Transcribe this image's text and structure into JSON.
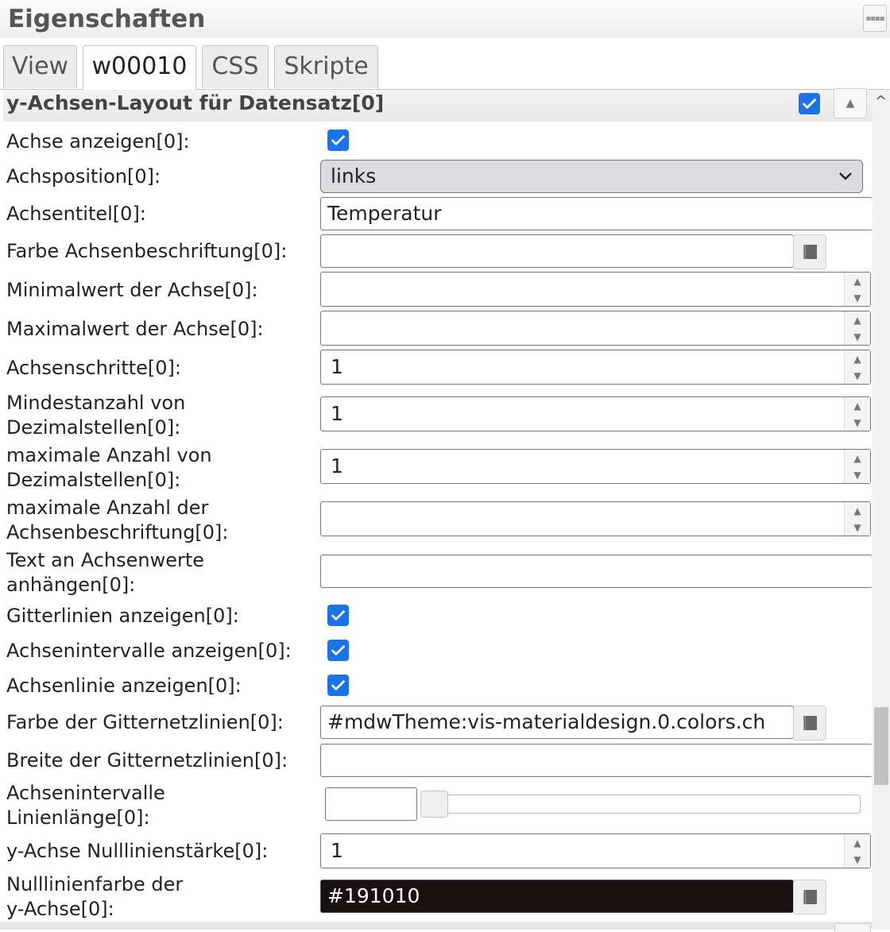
{
  "panel": {
    "title": "Eigenschaften"
  },
  "tabs": [
    "View",
    "w00010",
    "CSS",
    "Skripte"
  ],
  "active_tab": "w00010",
  "section": {
    "title": "y-Achsen-Layout für Datensatz[0]",
    "enabled": true
  },
  "fields": {
    "show_axis": {
      "label": "Achse anzeigen[0]:",
      "checked": true
    },
    "axis_position": {
      "label": "Achsposition[0]:",
      "value": "links"
    },
    "axis_title": {
      "label": "Achsentitel[0]:",
      "value": "Temperatur"
    },
    "axis_label_color": {
      "label": "Farbe Achsenbeschriftung[0]:",
      "value": ""
    },
    "axis_min": {
      "label": "Minimalwert der Achse[0]:",
      "value": ""
    },
    "axis_max": {
      "label": "Maximalwert der Achse[0]:",
      "value": ""
    },
    "axis_steps": {
      "label": "Achsenschritte[0]:",
      "value": "1"
    },
    "min_decimals": {
      "label1": "Mindestanzahl von",
      "label2": "Dezimalstellen[0]:",
      "value": "1"
    },
    "max_decimals": {
      "label1": "maximale Anzahl von",
      "label2": "Dezimalstellen[0]:",
      "value": "1"
    },
    "max_axis_labels": {
      "label1": "maximale Anzahl der",
      "label2": "Achsenbeschriftung[0]:",
      "value": ""
    },
    "append_text": {
      "label1": "Text an Achsenwerte",
      "label2": "anhängen[0]:",
      "value": ""
    },
    "show_gridlines": {
      "label": "Gitterlinien anzeigen[0]:",
      "checked": true
    },
    "show_intervals": {
      "label": "Achsenintervalle anzeigen[0]:",
      "checked": true
    },
    "show_axis_line": {
      "label": "Achsenlinie anzeigen[0]:",
      "checked": true
    },
    "grid_color": {
      "label": "Farbe der Gitternetzlinien[0]:",
      "value": "#mdwTheme:vis-materialdesign.0.colors.ch"
    },
    "grid_width": {
      "label": "Breite der Gitternetzlinien[0]:",
      "value": ""
    },
    "interval_length": {
      "label1": "Achsenintervalle",
      "label2": "Linienlänge[0]:",
      "value": "",
      "slider_fraction": 0
    },
    "zero_line_width": {
      "label": "y-Achse Nulllinienstärke[0]:",
      "value": "1"
    },
    "zero_line_color": {
      "label1": "Nulllinienfarbe der",
      "label2": "y-Achse[0]:",
      "value": "#191010"
    }
  },
  "colors": {
    "accent": "#1a73e8",
    "zero_line_bg": "#191010"
  },
  "icons": {
    "checkbox": "check-icon",
    "dropdown": "chevron-down-icon",
    "spinner_up": "caret-up-icon",
    "spinner_down": "caret-down-icon",
    "color_picker": "color-picker-icon"
  }
}
